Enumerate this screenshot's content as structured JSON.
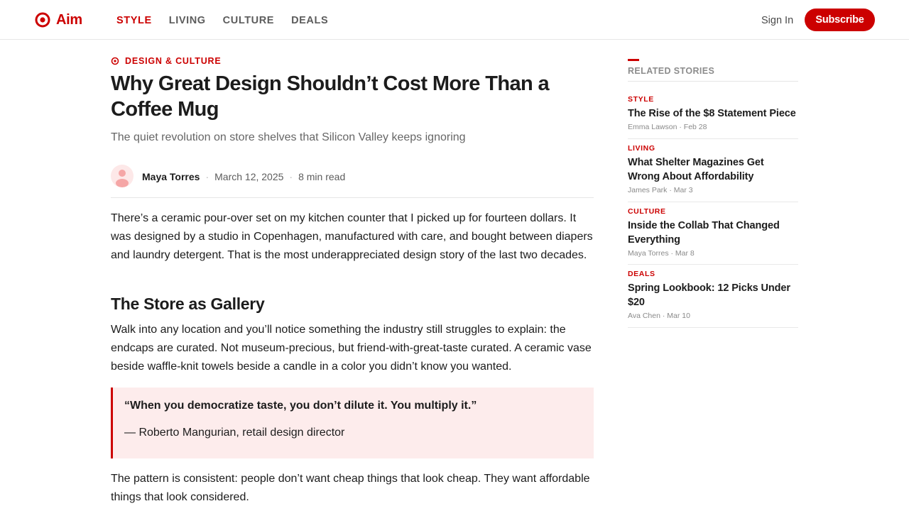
{
  "header": {
    "brand": "Aim",
    "nav": [
      "STYLE",
      "LIVING",
      "CULTURE",
      "DEALS"
    ],
    "sign_in": "Sign In",
    "subscribe": "Subscribe"
  },
  "colors": {
    "accent": "#cc0000",
    "quote_bg": "#fdecec",
    "text": "#1c1c1c",
    "muted": "#666666"
  },
  "article": {
    "kicker": "DESIGN & CULTURE",
    "headline": "Why Great Design Shouldn’t Cost More Than a Coffee Mug",
    "dek": "The quiet revolution on store shelves that Silicon Valley keeps ignoring",
    "author": "Maya Torres",
    "date": "March 12, 2025",
    "read_time": "8 min read",
    "separator": "·",
    "para1": "There’s a ceramic pour-over set on my kitchen counter that I picked up for fourteen dollars. It was designed by a studio in Copenhagen, manufactured with care, and bought between diapers and laundry detergent. That is the most underappreciated design story of the last two decades.",
    "section_heading": "The Store as Gallery",
    "para2": "Walk into any location and you’ll notice something the industry still struggles to explain: the endcaps are curated. Not museum-precious, but friend-with-great-taste curated. A ceramic vase beside waffle-knit towels beside a candle in a color you didn’t know you wanted.",
    "quote": "“When you democratize taste, you don’t dilute it. You multiply it.”",
    "quote_attribution": "— Roberto Mangurian, retail design director",
    "para3": "The pattern is consistent: people don’t want cheap things that look cheap. They want affordable things that look considered."
  },
  "sidebar": {
    "heading": "RELATED STORIES",
    "stories": [
      {
        "category": "STYLE",
        "title": "The Rise of the $8 Statement Piece",
        "author": "Emma Lawson",
        "date": "Feb 28"
      },
      {
        "category": "LIVING",
        "title": "What Shelter Magazines Get Wrong About Affordability",
        "author": "James Park",
        "date": "Mar 3"
      },
      {
        "category": "CULTURE",
        "title": "Inside the Collab That Changed Everything",
        "author": "Maya Torres",
        "date": "Mar 8"
      },
      {
        "category": "DEALS",
        "title": "Spring Lookbook: 12 Picks Under $20",
        "author": "Ava Chen",
        "date": "Mar 10"
      }
    ],
    "meta_separator": " · "
  }
}
